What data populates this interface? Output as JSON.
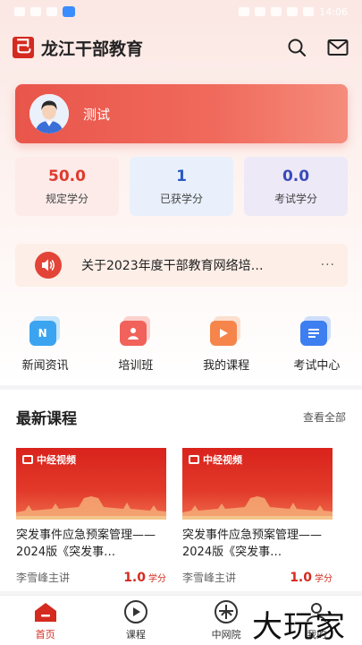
{
  "status_bar": {
    "time": "14:06"
  },
  "app": {
    "title": "龙江干部教育",
    "logo_char": "己"
  },
  "header": {
    "search_icon": "search-icon",
    "mail_icon": "mail-icon"
  },
  "profile": {
    "name": "测试"
  },
  "credits": [
    {
      "value": "50.0",
      "label": "规定学分",
      "color": "#e03a2f"
    },
    {
      "value": "1",
      "label": "已获学分",
      "color": "#2b59c3"
    },
    {
      "value": "0.0",
      "label": "考试学分",
      "color": "#3b4bb8"
    }
  ],
  "notice": {
    "text": "关于2023年度干部教育网络培…",
    "more": "···"
  },
  "quick_nav": [
    {
      "label": "新闻资讯",
      "icon": "news-icon",
      "glyph": "N",
      "color": "#3ba4f0"
    },
    {
      "label": "培训班",
      "icon": "training-icon",
      "glyph": "",
      "color": "#f0625a"
    },
    {
      "label": "我的课程",
      "icon": "my-courses-icon",
      "glyph": "",
      "color": "#f5854a"
    },
    {
      "label": "考试中心",
      "icon": "exam-center-icon",
      "glyph": "",
      "color": "#3d7ef0"
    }
  ],
  "courses": {
    "title": "最新课程",
    "see_all": "查看全部",
    "items": [
      {
        "brand": "中经视频",
        "title": "突发事件应急预案管理——2024版《突发事…",
        "lecturer": "李雪峰主讲",
        "credit": "1.0",
        "unit": "学分"
      },
      {
        "brand": "中经视频",
        "title": "突发事件应急预案管理——2024版《突发事…",
        "lecturer": "李雪峰主讲",
        "credit": "1.0",
        "unit": "学分"
      }
    ]
  },
  "bottom_nav": [
    {
      "label": "首页",
      "icon": "home-icon",
      "active": true
    },
    {
      "label": "课程",
      "icon": "play-icon",
      "active": false
    },
    {
      "label": "中网院",
      "icon": "cnn-college-icon",
      "active": false
    },
    {
      "label": "我的",
      "icon": "user-icon",
      "active": false
    }
  ],
  "watermark": "大玩家",
  "colors": {
    "accent": "#d42a1f",
    "card_red": "#e9554a"
  }
}
